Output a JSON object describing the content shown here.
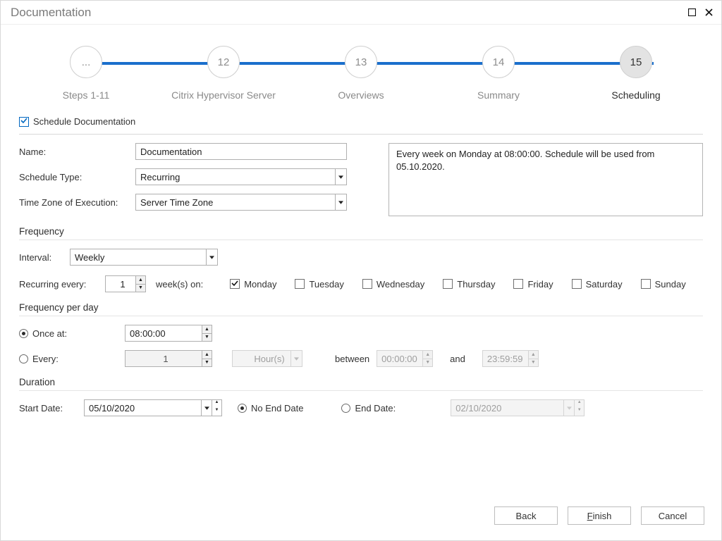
{
  "window": {
    "title": "Documentation"
  },
  "stepper": {
    "steps": [
      {
        "circle": "...",
        "label": "Steps 1-11"
      },
      {
        "circle": "12",
        "label": "Citrix Hypervisor Server"
      },
      {
        "circle": "13",
        "label": "Overviews"
      },
      {
        "circle": "14",
        "label": "Summary"
      },
      {
        "circle": "15",
        "label": "Scheduling"
      }
    ]
  },
  "schedule": {
    "enable_label": "Schedule Documentation",
    "name_label": "Name:",
    "name_value": "Documentation",
    "type_label": "Schedule Type:",
    "type_value": "Recurring",
    "tz_label": "Time Zone of Execution:",
    "tz_value": "Server Time Zone",
    "summary": "Every week on Monday at 08:00:00. Schedule will be used from 05.10.2020."
  },
  "frequency": {
    "header": "Frequency",
    "interval_label": "Interval:",
    "interval_value": "Weekly",
    "recurring_label": "Recurring every:",
    "recurring_value": "1",
    "weeks_on_label": "week(s) on:",
    "days": {
      "mon": "Monday",
      "tue": "Tuesday",
      "wed": "Wednesday",
      "thu": "Thursday",
      "fri": "Friday",
      "sat": "Saturday",
      "sun": "Sunday"
    }
  },
  "per_day": {
    "header": "Frequency per day",
    "once_label": "Once at:",
    "once_value": "08:00:00",
    "every_label": "Every:",
    "every_value": "1",
    "every_unit": "Hour(s)",
    "between_label": "between",
    "between_from": "00:00:00",
    "and_label": "and",
    "between_to": "23:59:59"
  },
  "duration": {
    "header": "Duration",
    "start_label": "Start Date:",
    "start_value": "05/10/2020",
    "no_end_label": "No End Date",
    "end_label": "End Date:",
    "end_value": "02/10/2020"
  },
  "footer": {
    "back": "Back",
    "finish_pre": "",
    "finish_mn": "F",
    "finish_post": "inish",
    "cancel": "Cancel"
  }
}
